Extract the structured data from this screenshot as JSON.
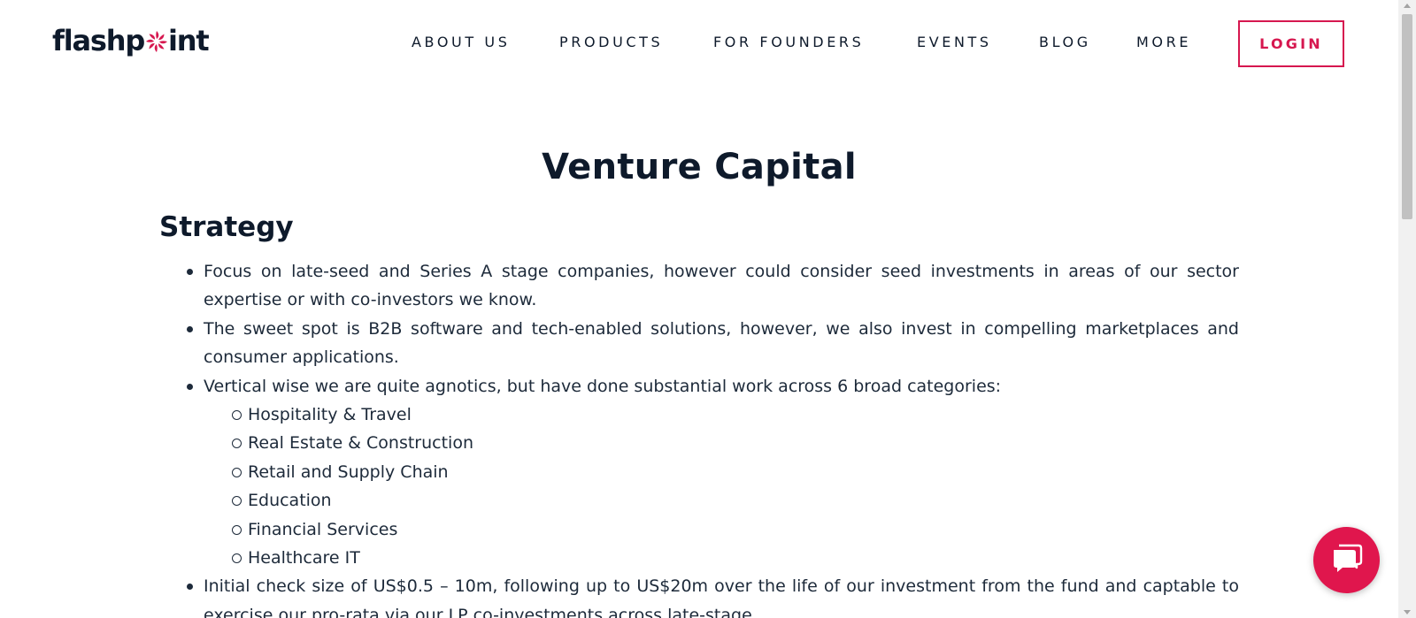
{
  "brand": {
    "logo_before": "flashp",
    "logo_after": "int",
    "accent_color": "#d6174f"
  },
  "nav": {
    "items": [
      "ABOUT US",
      "PRODUCTS",
      "FOR FOUNDERS",
      "EVENTS",
      "BLOG",
      "MORE"
    ],
    "login_label": "LOGIN"
  },
  "main": {
    "title": "Venture Capital",
    "section_title": "Strategy",
    "bullets": [
      "Focus on late-seed and Series A stage companies, however could consider seed investments in areas of our sector expertise or with co-investors we know.",
      "The sweet spot is B2B software and tech-enabled solutions, however, we also invest in compelling marketplaces and consumer applications.",
      "Vertical wise we are quite agnotics, but have done substantial work across 6 broad categories:"
    ],
    "categories": [
      "Hospitality & Travel",
      "Real Estate & Construction",
      "Retail and Supply Chain",
      "Education",
      "Financial Services",
      "Healthcare IT"
    ],
    "bullet_last": "Initial check size of US$0.5 – 10m, following up to US$20m over the life of our investment from the fund and captable to exercise our pro-rata via our LP co-investments across late-stage."
  },
  "chat": {
    "icon": "chat-bubble-icon",
    "color": "#e0164d"
  }
}
